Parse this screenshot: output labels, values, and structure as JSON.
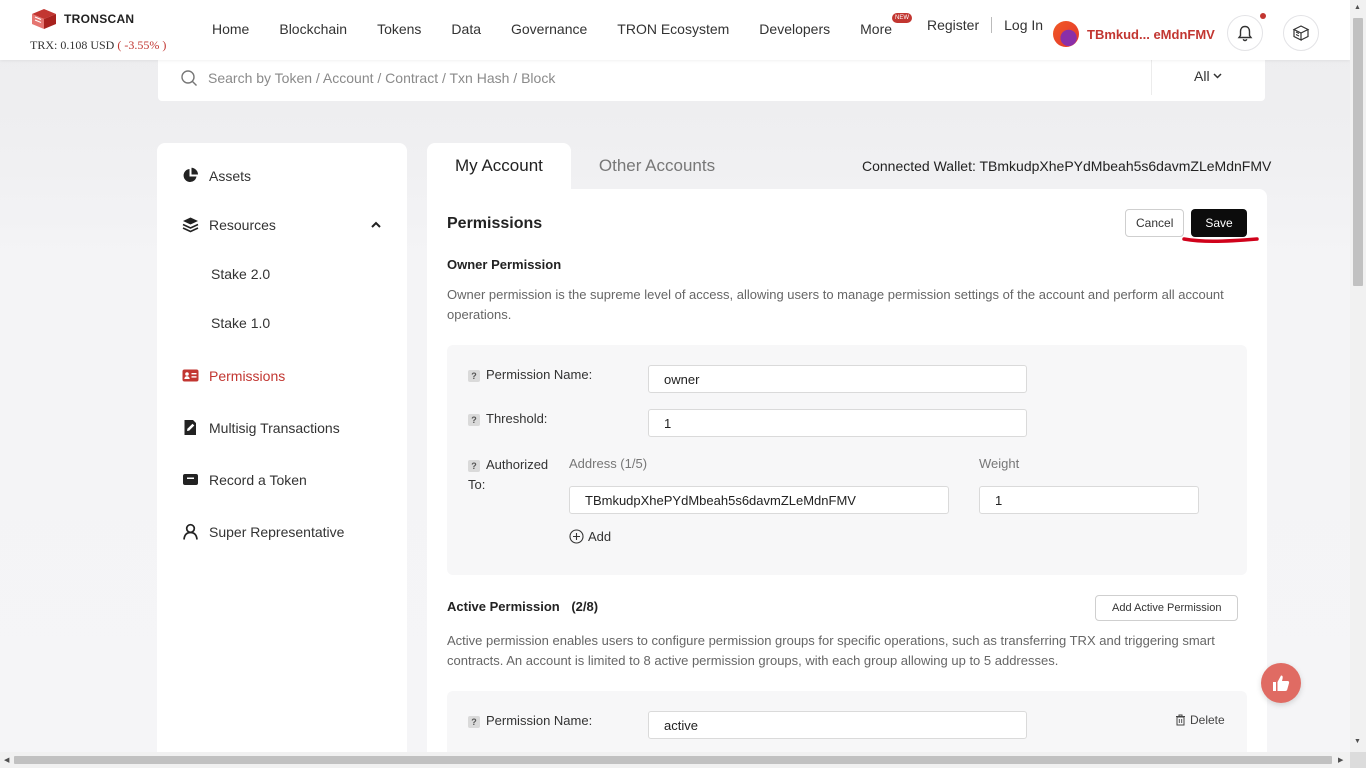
{
  "header": {
    "logo_text": "TRONSCAN",
    "price_label": "TRX: 0.108 USD",
    "price_change": "( -3.55% )",
    "nav": [
      "Home",
      "Blockchain",
      "Tokens",
      "Data",
      "Governance",
      "TRON Ecosystem",
      "Developers",
      "More"
    ],
    "new_badge": "NEW",
    "register": "Register",
    "login": "Log In",
    "wallet_short": "TBmkud... eMdnFMV"
  },
  "search": {
    "placeholder": "Search by Token / Account / Contract / Txn Hash / Block",
    "filter": "All"
  },
  "sidebar": {
    "assets": "Assets",
    "resources": "Resources",
    "stake2": "Stake 2.0",
    "stake1": "Stake 1.0",
    "permissions": "Permissions",
    "multisig": "Multisig Transactions",
    "record_token": "Record a Token",
    "super_rep": "Super Representative"
  },
  "tabs": {
    "my_account": "My Account",
    "other_accounts": "Other Accounts"
  },
  "connected_wallet": "Connected Wallet: TBmkudpXhePYdMbeah5s6davmZLeMdnFMV",
  "main": {
    "title": "Permissions",
    "cancel": "Cancel",
    "save": "Save",
    "owner": {
      "title": "Owner Permission",
      "desc": "Owner permission is the supreme level of access, allowing users to manage permission settings of the account and perform all account operations.",
      "name_label": "Permission Name:",
      "name_value": "owner",
      "threshold_label": "Threshold:",
      "threshold_value": "1",
      "authorized_label": "Authorized",
      "authorized_label2": "To:",
      "address_head": "Address (1/5)",
      "weight_head": "Weight",
      "address_value": "TBmkudpXhePYdMbeah5s6davmZLeMdnFMV",
      "weight_value": "1",
      "add": "Add"
    },
    "active": {
      "title": "Active Permission",
      "count": "(2/8)",
      "add_button": "Add Active Permission",
      "desc": "Active permission enables users to configure permission groups for specific operations, such as transferring TRX and triggering smart contracts. An account is limited to 8 active permission groups, with each group allowing up to 5 addresses.",
      "name_label": "Permission Name:",
      "name_value": "active",
      "delete": "Delete"
    }
  },
  "colors": {
    "accent": "#c23631",
    "annotation": "#d0021b",
    "save_bg": "#0c0c0c"
  }
}
